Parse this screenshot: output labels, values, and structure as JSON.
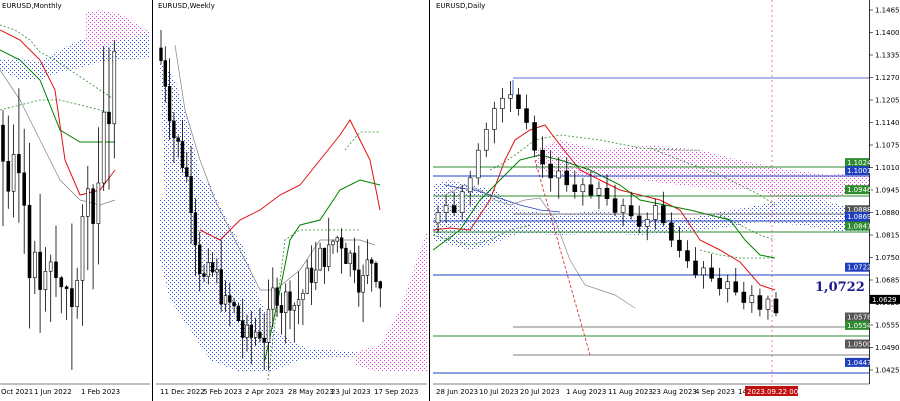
{
  "panes": [
    {
      "title": "EURUSD,Monthly",
      "dates": [
        "Oct 2021",
        "1 Jun 2022",
        "1 Feb 2023"
      ]
    },
    {
      "title": "EURUSD,Weekly",
      "dates": [
        "11 Dec 2022",
        "5 Feb 2023",
        "2 Apr 2023",
        "28 May 2023",
        "23 Jul 2023",
        "17 Sep 2023"
      ]
    },
    {
      "title": "EURUSD,Daily",
      "dates": [
        "28 Jun 2023",
        "10 Jul 2023",
        "20 Jul 2023",
        "1 Aug 2023",
        "11 Aug 2023",
        "23 Aug 2023",
        "4 Sep 2023",
        "14"
      ],
      "cursor_date": "2023.09.22 00:00",
      "price_scale": [
        "1.1465",
        "1.1400",
        "1.1335",
        "1.1270",
        "1.1205",
        "1.1140",
        "1.1075",
        "1.1010",
        "1.0945",
        "1.0880",
        "1.0815",
        "1.0750",
        "1.0685",
        "1.0620",
        "1.0555",
        "1.0490",
        "1.0425"
      ],
      "level_tags": [
        {
          "text": "1.1024",
          "color": "#2e8b2e"
        },
        {
          "text": "1.1001",
          "color": "#1f3fbf"
        },
        {
          "text": "1.0946",
          "color": "#2e8b2e"
        },
        {
          "text": "1.0888",
          "color": "#555555"
        },
        {
          "text": "1.0869",
          "color": "#1f3fbf"
        },
        {
          "text": "1.0841",
          "color": "#2e8b2e"
        },
        {
          "text": "1.0722",
          "color": "#1f3fbf"
        },
        {
          "text": "1.0578",
          "color": "#555555"
        },
        {
          "text": "1.0554",
          "color": "#2e8b2e"
        },
        {
          "text": "1.0500",
          "color": "#555555"
        },
        {
          "text": "1.0447",
          "color": "#1f3fbf"
        }
      ],
      "current_price": "1.0629",
      "annotation": "1,0722"
    }
  ],
  "chart_data": {
    "type": "candlestick",
    "symbol": "EURUSD",
    "timeframes": [
      "Monthly",
      "Weekly",
      "Daily"
    ],
    "daily_y_range": [
      1.0425,
      1.1465
    ],
    "horizontal_levels": [
      1.1024,
      1.1001,
      1.0946,
      1.0888,
      1.0869,
      1.0841,
      1.0722,
      1.0578,
      1.0554,
      1.05,
      1.0447
    ],
    "last_close": 1.0629,
    "daily_ohlc_approx": [
      [
        1.085,
        1.09,
        1.082,
        1.088
      ],
      [
        1.088,
        1.093,
        1.085,
        1.09
      ],
      [
        1.09,
        1.094,
        1.087,
        1.088
      ],
      [
        1.088,
        1.096,
        1.086,
        1.094
      ],
      [
        1.094,
        1.1,
        1.09,
        1.098
      ],
      [
        1.098,
        1.108,
        1.096,
        1.106
      ],
      [
        1.106,
        1.114,
        1.104,
        1.112
      ],
      [
        1.112,
        1.12,
        1.108,
        1.118
      ],
      [
        1.118,
        1.124,
        1.114,
        1.121
      ],
      [
        1.121,
        1.126,
        1.117,
        1.122
      ],
      [
        1.122,
        1.124,
        1.116,
        1.118
      ],
      [
        1.118,
        1.122,
        1.112,
        1.114
      ],
      [
        1.114,
        1.116,
        1.104,
        1.106
      ],
      [
        1.106,
        1.11,
        1.098,
        1.102
      ],
      [
        1.102,
        1.106,
        1.094,
        1.098
      ],
      [
        1.098,
        1.104,
        1.092,
        1.1
      ],
      [
        1.1,
        1.104,
        1.094,
        1.096
      ],
      [
        1.096,
        1.1,
        1.092,
        1.094
      ],
      [
        1.094,
        1.098,
        1.09,
        1.096
      ],
      [
        1.096,
        1.1,
        1.092,
        1.093
      ],
      [
        1.093,
        1.097,
        1.089,
        1.095
      ],
      [
        1.095,
        1.099,
        1.09,
        1.092
      ],
      [
        1.092,
        1.096,
        1.087,
        1.088
      ],
      [
        1.088,
        1.092,
        1.084,
        1.09
      ],
      [
        1.09,
        1.094,
        1.086,
        1.087
      ],
      [
        1.087,
        1.09,
        1.082,
        1.084
      ],
      [
        1.084,
        1.088,
        1.08,
        1.086
      ],
      [
        1.086,
        1.092,
        1.083,
        1.09
      ],
      [
        1.09,
        1.094,
        1.084,
        1.085
      ],
      [
        1.085,
        1.088,
        1.078,
        1.08
      ],
      [
        1.08,
        1.084,
        1.075,
        1.077
      ],
      [
        1.077,
        1.08,
        1.072,
        1.074
      ],
      [
        1.074,
        1.078,
        1.069,
        1.07
      ],
      [
        1.07,
        1.074,
        1.066,
        1.072
      ],
      [
        1.072,
        1.076,
        1.068,
        1.069
      ],
      [
        1.069,
        1.072,
        1.064,
        1.066
      ],
      [
        1.066,
        1.07,
        1.062,
        1.068
      ],
      [
        1.068,
        1.072,
        1.064,
        1.065
      ],
      [
        1.065,
        1.068,
        1.06,
        1.062
      ],
      [
        1.062,
        1.067,
        1.059,
        1.064
      ],
      [
        1.064,
        1.066,
        1.058,
        1.06
      ],
      [
        1.06,
        1.064,
        1.057,
        1.063
      ],
      [
        1.063,
        1.065,
        1.058,
        1.059
      ]
    ]
  }
}
